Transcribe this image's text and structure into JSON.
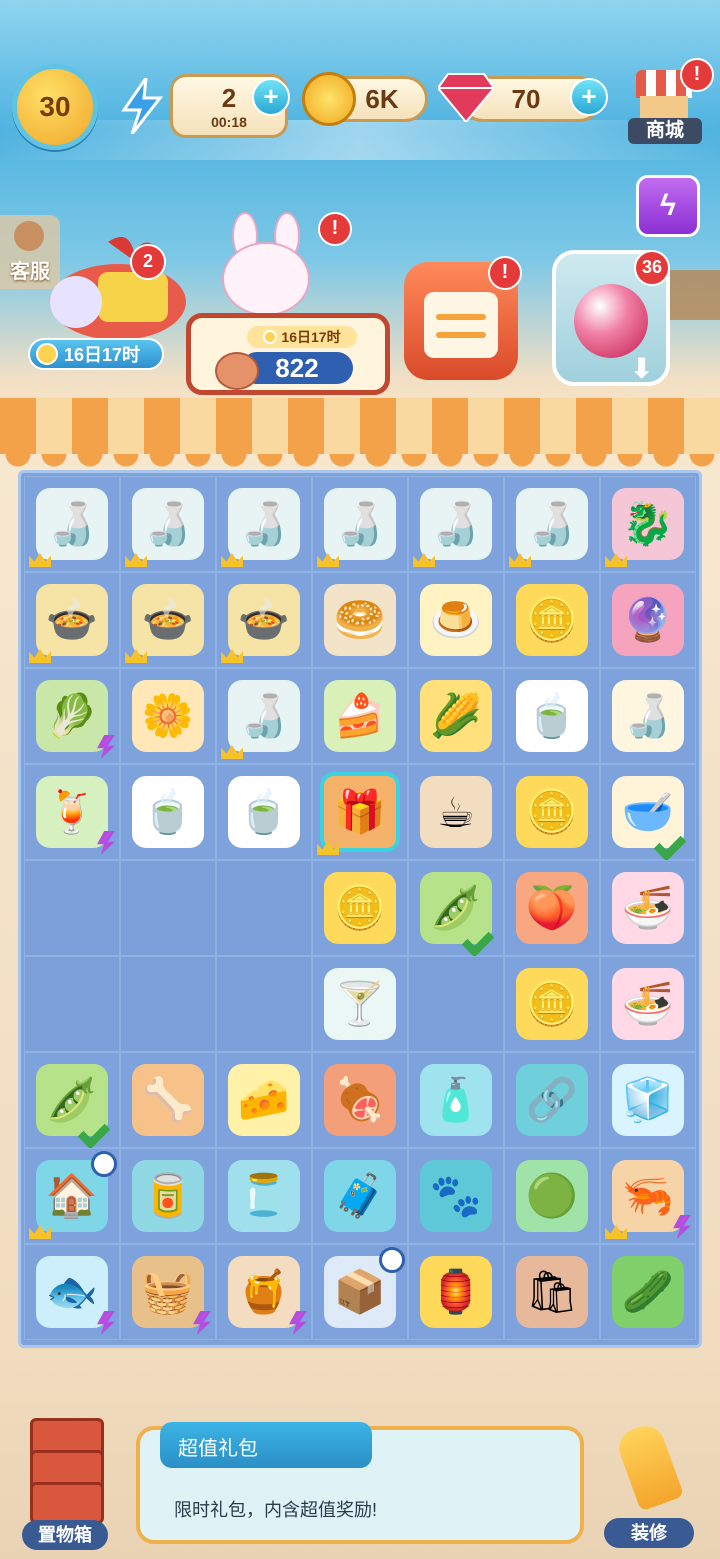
{
  "hud": {
    "level": "30",
    "energy": {
      "value": "2",
      "timer": "00:18"
    },
    "coins": "6K",
    "gems": "70",
    "shop_label": "商城",
    "customer_service_label": "客服"
  },
  "events": {
    "gift_count": "2",
    "gift_timer": "16日17时",
    "festival_timer": "16日17时",
    "festival_points": "822",
    "bubble_count": "36"
  },
  "board": {
    "rows": [
      [
        "tea-set",
        "tea-set",
        "tea-set",
        "tea-set",
        "tea-set",
        "tea-set",
        "dragon-fruit"
      ],
      [
        "corn-soup",
        "corn-soup",
        "corn-soup",
        "sesame-bun",
        "egg-custard",
        "gold-coins",
        "energy-orb"
      ],
      [
        "bok-choy-basket",
        "flower-cake",
        "tea-set",
        "mung-bean-cake",
        "corn",
        "lemon-tea",
        "sake-bottle"
      ],
      [
        "juicer",
        "lemon-tea",
        "lemon-tea",
        "gift-box",
        "milk-tea",
        "gold-coin",
        "tofu-pudding"
      ],
      [
        "",
        "",
        "",
        "gold-coin",
        "pea-pod",
        "peach",
        "ramen-bowl"
      ],
      [
        "",
        "",
        "",
        "small-cup",
        "",
        "gold-coins",
        "ramen-bowl"
      ],
      [
        "pea-pod",
        "bone-treat",
        "cheese-packs",
        "meat-chunks",
        "pet-spray",
        "pet-collar",
        "ice-cube"
      ],
      [
        "dog-house",
        "pet-bowl",
        "treat-jar",
        "pet-carrier",
        "paw-badge",
        "green-orb",
        "seafood-platter"
      ],
      [
        "fish-bowl",
        "picnic-basket",
        "clay-pot",
        "pet-dryer",
        "coin-fan",
        "paper-bag",
        "cucumber"
      ]
    ]
  },
  "bottom": {
    "storage_label": "置物箱",
    "info_title": "超值礼包",
    "info_desc": "限时礼包，内含超值奖励!",
    "decor_label": "装修"
  },
  "colors": {
    "board_bg": "#7fa3d8",
    "accent_blue": "#2f8fcf",
    "alert_red": "#e53a3a"
  }
}
